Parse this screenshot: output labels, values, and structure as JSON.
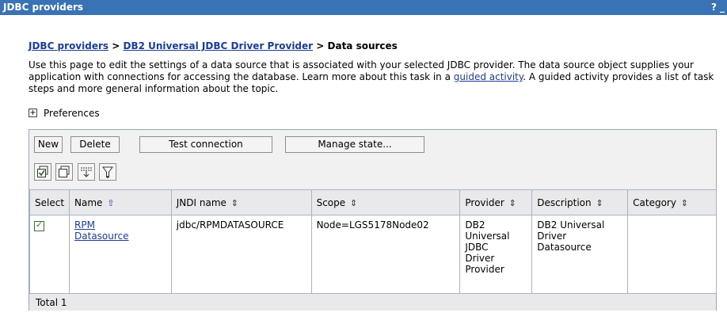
{
  "window": {
    "title": "JDBC providers",
    "help_label": "?",
    "minimize_label": "_"
  },
  "breadcrumb": {
    "items": [
      "JDBC providers",
      "DB2 Universal JDBC Driver Provider"
    ],
    "separator": ">",
    "current": "Data sources"
  },
  "description": {
    "text_before": "Use this page to edit the settings of a data source that is associated with your selected JDBC provider. The data source object supplies your application with connections for accessing the database. Learn more about this task in a ",
    "link_text": "guided activity",
    "text_after": ". A guided activity provides a list of task steps and more general information about the topic."
  },
  "preferences": {
    "expander": "+",
    "label": "Preferences"
  },
  "toolbar": {
    "new_label": "New",
    "delete_label": "Delete",
    "test_connection_label": "Test connection",
    "manage_state_label": "Manage state..."
  },
  "icon_toolbar": [
    "select-all-icon",
    "deselect-all-icon",
    "show-filter-icon",
    "clear-filter-icon"
  ],
  "table": {
    "columns": [
      "Select",
      "Name",
      "JNDI name",
      "Scope",
      "Provider",
      "Description",
      "Category"
    ],
    "rows": [
      {
        "selected": true,
        "name_line1": "RPM",
        "name_line2": "Datasource",
        "jndi": "jdbc/RPMDATASOURCE",
        "scope": "Node=LGS5178Node02",
        "provider": [
          "DB2",
          "Universal",
          "JDBC",
          "Driver",
          "Provider"
        ],
        "description": [
          "DB2 Universal",
          "Driver",
          "Datasource"
        ],
        "category": ""
      }
    ],
    "total_label": "Total 1"
  },
  "colors": {
    "titlebar": "#3a73b5",
    "link": "#1a3d9c",
    "header_bg": "#e9e9ec",
    "panel_bg": "#f1f1f1"
  }
}
